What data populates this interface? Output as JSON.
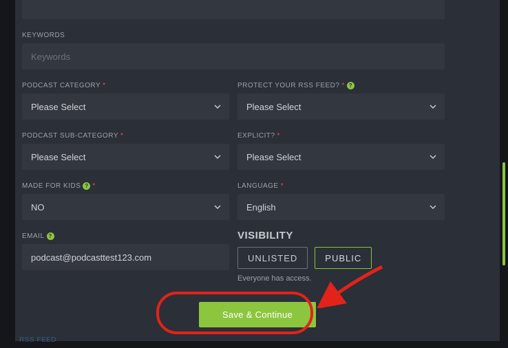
{
  "fields": {
    "keywords_label": "KEYWORDS",
    "keywords_placeholder": "Keywords",
    "category_label": "PODCAST CATEGORY",
    "category_value": "Please Select",
    "rss_label": "PROTECT YOUR RSS FEED?",
    "rss_value": "Please Select",
    "subcategory_label": "PODCAST SUB-CATEGORY",
    "subcategory_value": "Please Select",
    "explicit_label": "EXPLICIT?",
    "explicit_value": "Please Select",
    "kids_label": "MADE FOR KIDS",
    "kids_value": "NO",
    "language_label": "LANGUAGE",
    "language_value": "English",
    "email_label": "EMAIL",
    "email_value": "podcast@podcasttest123.com"
  },
  "visibility": {
    "title": "VISIBILITY",
    "unlisted": "UNLISTED",
    "public": "PUBLIC",
    "help": "Everyone has access."
  },
  "actions": {
    "save": "Save & Continue"
  },
  "footer": {
    "rss_link": "RSS FEED"
  }
}
